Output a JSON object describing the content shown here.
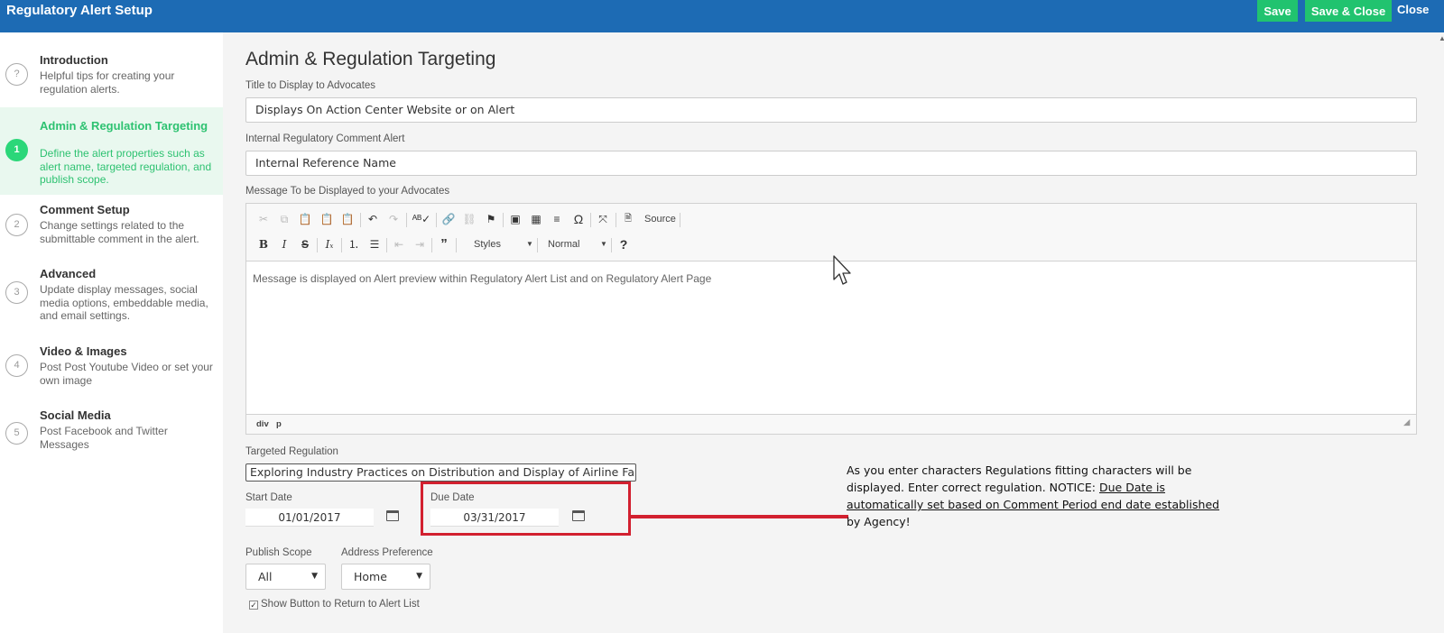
{
  "header": {
    "title": "Regulatory Alert Setup",
    "save_label": "Save",
    "save_close_label": "Save & Close",
    "close_label": "Close"
  },
  "sidebar": {
    "steps": [
      {
        "marker": "?",
        "title": "Introduction",
        "description": "Helpful tips for creating your regulation alerts."
      },
      {
        "marker": "1",
        "title": "Admin & Regulation Targeting",
        "description": "Define the alert properties such as alert name, targeted regulation, and publish scope."
      },
      {
        "marker": "2",
        "title": "Comment Setup",
        "description": "Change settings related to the submittable comment in the alert."
      },
      {
        "marker": "3",
        "title": "Advanced",
        "description": "Update display messages, social media options, embeddable media, and email settings."
      },
      {
        "marker": "4",
        "title": "Video & Images",
        "description": "Post Post Youtube Video or set your own image"
      },
      {
        "marker": "5",
        "title": "Social Media",
        "description": "Post Facebook and Twitter Messages"
      }
    ]
  },
  "main": {
    "title": "Admin & Regulation Targeting",
    "title_field": {
      "label": "Title to Display to Advocates",
      "value": "Displays On Action Center Website or on Alert"
    },
    "internal_field": {
      "label": "Internal Regulatory Comment Alert",
      "value": "Internal Reference Name"
    },
    "message": {
      "label": "Message To be Displayed to your Advocates",
      "toolbar": {
        "source_label": "Source",
        "styles_label": "Styles",
        "format_label": "Normal",
        "help_label": "?"
      },
      "content": "Message is displayed on Alert preview within Regulatory Alert List and on Regulatory Alert Page",
      "path": [
        "div",
        "p"
      ]
    },
    "targeted_regulation": {
      "label": "Targeted Regulation",
      "value": "Exploring Industry Practices on Distribution and Display of Airline Fare,"
    },
    "start_date": {
      "label": "Start Date",
      "value": "01/01/2017"
    },
    "due_date": {
      "label": "Due Date",
      "value": "03/31/2017"
    },
    "publish_scope": {
      "label": "Publish Scope",
      "value": "All"
    },
    "address_preference": {
      "label": "Address Preference",
      "value": "Home"
    },
    "show_button": {
      "label": "Show Button to Return to Alert List",
      "checked": true
    }
  },
  "annotation": {
    "text_plain": "As you enter characters Regulations fitting characters will be displayed. Enter correct regulation. NOTICE: ",
    "text_underlined": "Due Date is automatically set based on Comment Period end date established",
    "text_tail": " by Agency!",
    "color": "#d2202f"
  },
  "colors": {
    "header": "#1d6bb4",
    "accent": "#21c36f",
    "active_step": "#2ec271"
  }
}
